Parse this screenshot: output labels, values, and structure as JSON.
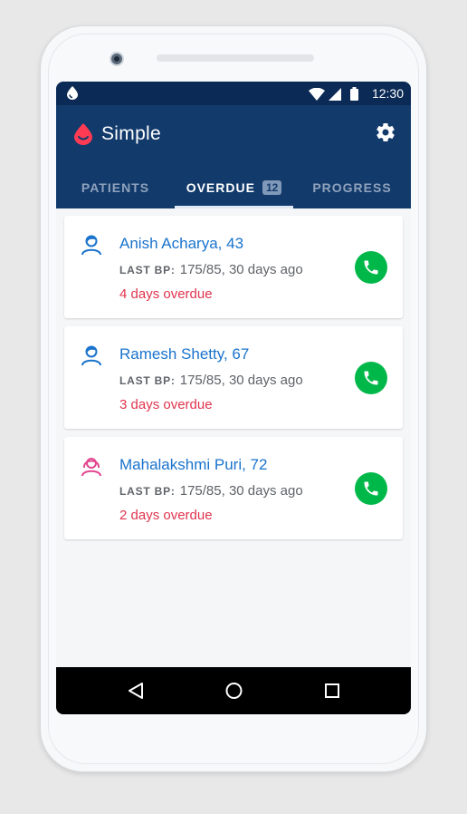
{
  "statusbar": {
    "time": "12:30"
  },
  "app": {
    "title": "Simple"
  },
  "tabs": [
    {
      "label": "PATIENTS"
    },
    {
      "label": "OVERDUE",
      "badge": "12"
    },
    {
      "label": "PROGRESS"
    }
  ],
  "bp_label": "LAST BP:",
  "patients": [
    {
      "name": "Anish Acharya, 43",
      "bp": "175/85, 30 days ago",
      "overdue": "4 days overdue",
      "gender": "male"
    },
    {
      "name": "Ramesh Shetty, 67",
      "bp": "175/85, 30 days ago",
      "overdue": "3 days overdue",
      "gender": "male"
    },
    {
      "name": "Mahalakshmi Puri, 72",
      "bp": "175/85, 30 days ago",
      "overdue": "2 days overdue",
      "gender": "female"
    }
  ],
  "colors": {
    "appbar": "#123a6b",
    "statusbar": "#0b2a55",
    "link": "#1a73cc",
    "overdue": "#e0344e",
    "call": "#00b849",
    "female_avatar": "#e2468f"
  },
  "icons": [
    "drop-icon",
    "wifi-icon",
    "signal-icon",
    "battery-icon",
    "logo-icon",
    "gear-icon",
    "male-avatar-icon",
    "female-avatar-icon",
    "phone-icon",
    "back-icon",
    "home-icon",
    "recents-icon"
  ]
}
